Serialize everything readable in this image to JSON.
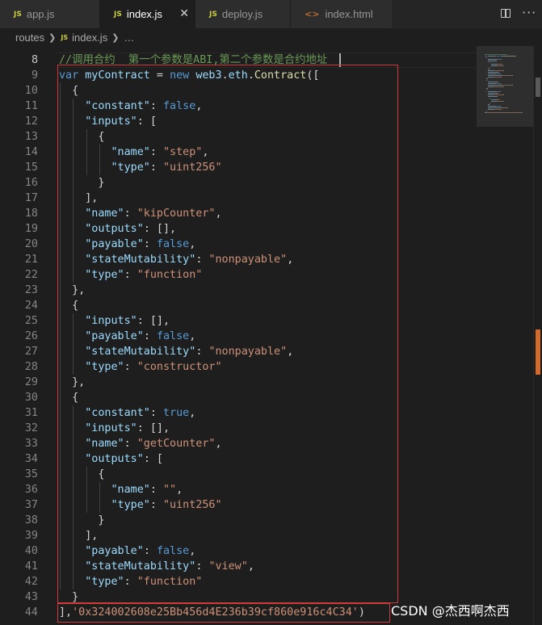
{
  "tabs": [
    {
      "icon": "JS",
      "label": "app.js",
      "active": false
    },
    {
      "icon": "JS",
      "label": "index.js",
      "active": true
    },
    {
      "icon": "JS",
      "label": "deploy.js",
      "active": false
    },
    {
      "icon": "<>",
      "label": "index.html",
      "active": false
    }
  ],
  "breadcrumb": {
    "folder": "routes",
    "file_icon": "JS",
    "file": "index.js",
    "symbol": "…"
  },
  "lines": [
    {
      "n": "8",
      "t": [
        [
          "c-cm",
          "//调用合约  第一个参数是ABI,第二个参数是合约地址"
        ]
      ]
    },
    {
      "n": "9",
      "t": [
        [
          "c-kw",
          "var"
        ],
        [
          "c-p",
          " "
        ],
        [
          "c-var",
          "myContract"
        ],
        [
          "c-p",
          " = "
        ],
        [
          "c-kw",
          "new"
        ],
        [
          "c-p",
          " "
        ],
        [
          "c-var",
          "web3"
        ],
        [
          "c-p",
          "."
        ],
        [
          "c-var",
          "eth"
        ],
        [
          "c-p",
          "."
        ],
        [
          "c-fn",
          "Contract"
        ],
        [
          "c-p",
          "(["
        ]
      ]
    },
    {
      "n": "10",
      "t": [
        [
          "c-p",
          "  {"
        ]
      ]
    },
    {
      "n": "11",
      "t": [
        [
          "c-p",
          "    "
        ],
        [
          "c-key",
          "\"constant\""
        ],
        [
          "c-p",
          ": "
        ],
        [
          "c-kw",
          "false"
        ],
        [
          "c-p",
          ","
        ]
      ]
    },
    {
      "n": "12",
      "t": [
        [
          "c-p",
          "    "
        ],
        [
          "c-key",
          "\"inputs\""
        ],
        [
          "c-p",
          ": ["
        ]
      ]
    },
    {
      "n": "13",
      "t": [
        [
          "c-p",
          "      {"
        ]
      ]
    },
    {
      "n": "14",
      "t": [
        [
          "c-p",
          "        "
        ],
        [
          "c-key",
          "\"name\""
        ],
        [
          "c-p",
          ": "
        ],
        [
          "c-str",
          "\"step\""
        ],
        [
          "c-p",
          ","
        ]
      ]
    },
    {
      "n": "15",
      "t": [
        [
          "c-p",
          "        "
        ],
        [
          "c-key",
          "\"type\""
        ],
        [
          "c-p",
          ": "
        ],
        [
          "c-str",
          "\"uint256\""
        ]
      ]
    },
    {
      "n": "16",
      "t": [
        [
          "c-p",
          "      }"
        ]
      ]
    },
    {
      "n": "17",
      "t": [
        [
          "c-p",
          "    ],"
        ]
      ]
    },
    {
      "n": "18",
      "t": [
        [
          "c-p",
          "    "
        ],
        [
          "c-key",
          "\"name\""
        ],
        [
          "c-p",
          ": "
        ],
        [
          "c-str",
          "\"kipCounter\""
        ],
        [
          "c-p",
          ","
        ]
      ]
    },
    {
      "n": "19",
      "t": [
        [
          "c-p",
          "    "
        ],
        [
          "c-key",
          "\"outputs\""
        ],
        [
          "c-p",
          ": [],"
        ]
      ]
    },
    {
      "n": "20",
      "t": [
        [
          "c-p",
          "    "
        ],
        [
          "c-key",
          "\"payable\""
        ],
        [
          "c-p",
          ": "
        ],
        [
          "c-kw",
          "false"
        ],
        [
          "c-p",
          ","
        ]
      ]
    },
    {
      "n": "21",
      "t": [
        [
          "c-p",
          "    "
        ],
        [
          "c-key",
          "\"stateMutability\""
        ],
        [
          "c-p",
          ": "
        ],
        [
          "c-str",
          "\"nonpayable\""
        ],
        [
          "c-p",
          ","
        ]
      ]
    },
    {
      "n": "22",
      "t": [
        [
          "c-p",
          "    "
        ],
        [
          "c-key",
          "\"type\""
        ],
        [
          "c-p",
          ": "
        ],
        [
          "c-str",
          "\"function\""
        ]
      ]
    },
    {
      "n": "23",
      "t": [
        [
          "c-p",
          "  },"
        ]
      ]
    },
    {
      "n": "24",
      "t": [
        [
          "c-p",
          "  {"
        ]
      ]
    },
    {
      "n": "25",
      "t": [
        [
          "c-p",
          "    "
        ],
        [
          "c-key",
          "\"inputs\""
        ],
        [
          "c-p",
          ": [],"
        ]
      ]
    },
    {
      "n": "26",
      "t": [
        [
          "c-p",
          "    "
        ],
        [
          "c-key",
          "\"payable\""
        ],
        [
          "c-p",
          ": "
        ],
        [
          "c-kw",
          "false"
        ],
        [
          "c-p",
          ","
        ]
      ]
    },
    {
      "n": "27",
      "t": [
        [
          "c-p",
          "    "
        ],
        [
          "c-key",
          "\"stateMutability\""
        ],
        [
          "c-p",
          ": "
        ],
        [
          "c-str",
          "\"nonpayable\""
        ],
        [
          "c-p",
          ","
        ]
      ]
    },
    {
      "n": "28",
      "t": [
        [
          "c-p",
          "    "
        ],
        [
          "c-key",
          "\"type\""
        ],
        [
          "c-p",
          ": "
        ],
        [
          "c-str",
          "\"constructor\""
        ]
      ]
    },
    {
      "n": "29",
      "t": [
        [
          "c-p",
          "  },"
        ]
      ]
    },
    {
      "n": "30",
      "t": [
        [
          "c-p",
          "  {"
        ]
      ]
    },
    {
      "n": "31",
      "t": [
        [
          "c-p",
          "    "
        ],
        [
          "c-key",
          "\"constant\""
        ],
        [
          "c-p",
          ": "
        ],
        [
          "c-kw",
          "true"
        ],
        [
          "c-p",
          ","
        ]
      ]
    },
    {
      "n": "32",
      "t": [
        [
          "c-p",
          "    "
        ],
        [
          "c-key",
          "\"inputs\""
        ],
        [
          "c-p",
          ": [],"
        ]
      ]
    },
    {
      "n": "33",
      "t": [
        [
          "c-p",
          "    "
        ],
        [
          "c-key",
          "\"name\""
        ],
        [
          "c-p",
          ": "
        ],
        [
          "c-str",
          "\"getCounter\""
        ],
        [
          "c-p",
          ","
        ]
      ]
    },
    {
      "n": "34",
      "t": [
        [
          "c-p",
          "    "
        ],
        [
          "c-key",
          "\"outputs\""
        ],
        [
          "c-p",
          ": ["
        ]
      ]
    },
    {
      "n": "35",
      "t": [
        [
          "c-p",
          "      {"
        ]
      ]
    },
    {
      "n": "36",
      "t": [
        [
          "c-p",
          "        "
        ],
        [
          "c-key",
          "\"name\""
        ],
        [
          "c-p",
          ": "
        ],
        [
          "c-str",
          "\"\""
        ],
        [
          "c-p",
          ","
        ]
      ]
    },
    {
      "n": "37",
      "t": [
        [
          "c-p",
          "        "
        ],
        [
          "c-key",
          "\"type\""
        ],
        [
          "c-p",
          ": "
        ],
        [
          "c-str",
          "\"uint256\""
        ]
      ]
    },
    {
      "n": "38",
      "t": [
        [
          "c-p",
          "      }"
        ]
      ]
    },
    {
      "n": "39",
      "t": [
        [
          "c-p",
          "    ],"
        ]
      ]
    },
    {
      "n": "40",
      "t": [
        [
          "c-p",
          "    "
        ],
        [
          "c-key",
          "\"payable\""
        ],
        [
          "c-p",
          ": "
        ],
        [
          "c-kw",
          "false"
        ],
        [
          "c-p",
          ","
        ]
      ]
    },
    {
      "n": "41",
      "t": [
        [
          "c-p",
          "    "
        ],
        [
          "c-key",
          "\"stateMutability\""
        ],
        [
          "c-p",
          ": "
        ],
        [
          "c-str",
          "\"view\""
        ],
        [
          "c-p",
          ","
        ]
      ]
    },
    {
      "n": "42",
      "t": [
        [
          "c-p",
          "    "
        ],
        [
          "c-key",
          "\"type\""
        ],
        [
          "c-p",
          ": "
        ],
        [
          "c-str",
          "\"function\""
        ]
      ]
    },
    {
      "n": "43",
      "t": [
        [
          "c-p",
          "  }"
        ]
      ]
    },
    {
      "n": "44",
      "t": [
        [
          "c-p",
          "],"
        ],
        [
          "c-str",
          "'0x324002608e25Bb456d4E236b39cf860e916c4C34'"
        ],
        [
          "c-p",
          ")"
        ]
      ]
    }
  ],
  "watermark": "CSDN @杰西啊杰西",
  "colors": {
    "accent_box": "#d03a3a",
    "background": "#1e1e1e",
    "js_icon": "#cbcb41",
    "html_icon": "#e37933"
  }
}
